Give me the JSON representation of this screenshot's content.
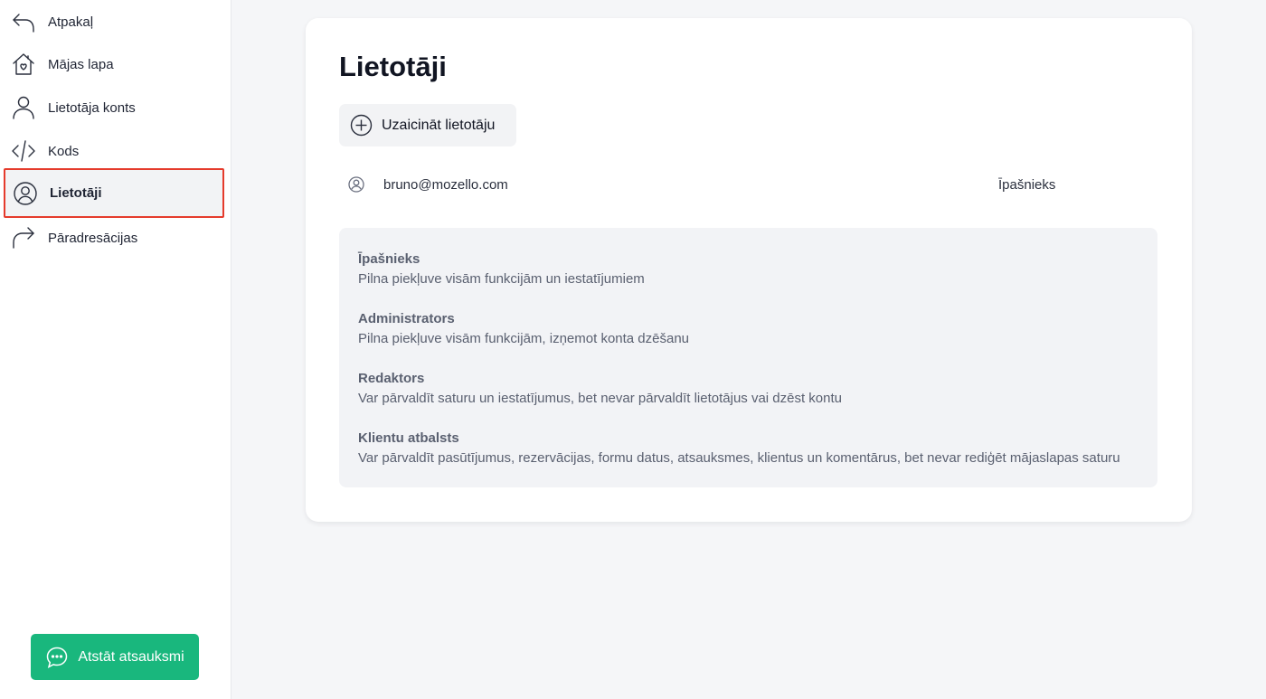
{
  "sidebar": {
    "items": [
      {
        "label": "Atpakaļ",
        "icon": "back-arrow-icon"
      },
      {
        "label": "Mājas lapa",
        "icon": "home-icon"
      },
      {
        "label": "Lietotāja konts",
        "icon": "person-icon"
      },
      {
        "label": "Kods",
        "icon": "code-icon"
      },
      {
        "label": "Lietotāji",
        "icon": "user-circle-icon",
        "active": true
      },
      {
        "label": "Pāradresācijas",
        "icon": "redirect-arrow-icon"
      }
    ],
    "feedback_label": "Atstāt atsauksmi",
    "feedback_color": "#19b77d",
    "active_outline_color": "#e53b2c"
  },
  "main": {
    "title": "Lietotāji",
    "invite_label": "Uzaicināt lietotāju",
    "users": [
      {
        "email": "bruno@mozello.com",
        "role": "Īpašnieks"
      }
    ],
    "roles": [
      {
        "name": "Īpašnieks",
        "description": "Pilna piekļuve visām funkcijām un iestatījumiem"
      },
      {
        "name": "Administrators",
        "description": "Pilna piekļuve visām funkcijām, izņemot konta dzēšanu"
      },
      {
        "name": "Redaktors",
        "description": "Var pārvaldīt saturu un iestatījumus, bet nevar pārvaldīt lietotājus vai dzēst kontu"
      },
      {
        "name": "Klientu atbalsts",
        "description": "Var pārvaldīt pasūtījumus, rezervācijas, formu datus, atsauksmes, klientus un komentārus, bet nevar rediģēt mājaslapas saturu"
      }
    ]
  }
}
